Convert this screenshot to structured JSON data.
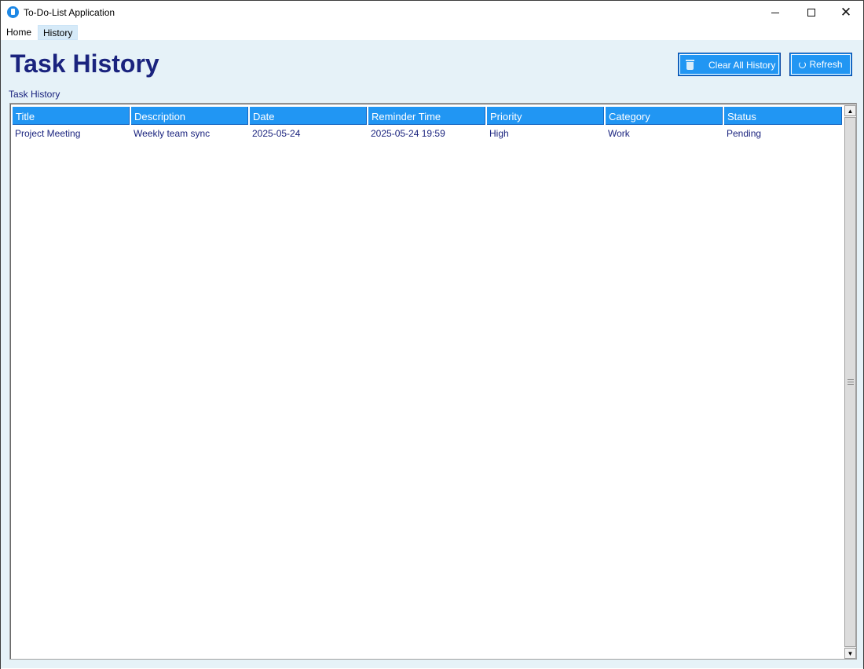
{
  "window": {
    "title": "To-Do-List Application",
    "controls": {
      "minimize": "minimize",
      "maximize": "maximize",
      "close": "✕"
    }
  },
  "menu": {
    "items": [
      {
        "label": "Home"
      },
      {
        "label": "History",
        "active": true
      }
    ]
  },
  "page": {
    "title": "Task History",
    "section_label": "Task History"
  },
  "toolbar": {
    "clear_label": "Clear All History",
    "clear_icon": "trash-icon",
    "refresh_label": "Refresh",
    "refresh_icon": "refresh-icon"
  },
  "table": {
    "columns": [
      "Title",
      "Description",
      "Date",
      "Reminder Time",
      "Priority",
      "Category",
      "Status"
    ],
    "rows": [
      [
        "Project Meeting",
        "Weekly team sync",
        "2025-05-24",
        "2025-05-24 19:59",
        "High",
        "Work",
        "Pending"
      ]
    ]
  },
  "colors": {
    "accent": "#2196f3",
    "title_text": "#1a237e",
    "background": "#e6f2f8"
  }
}
